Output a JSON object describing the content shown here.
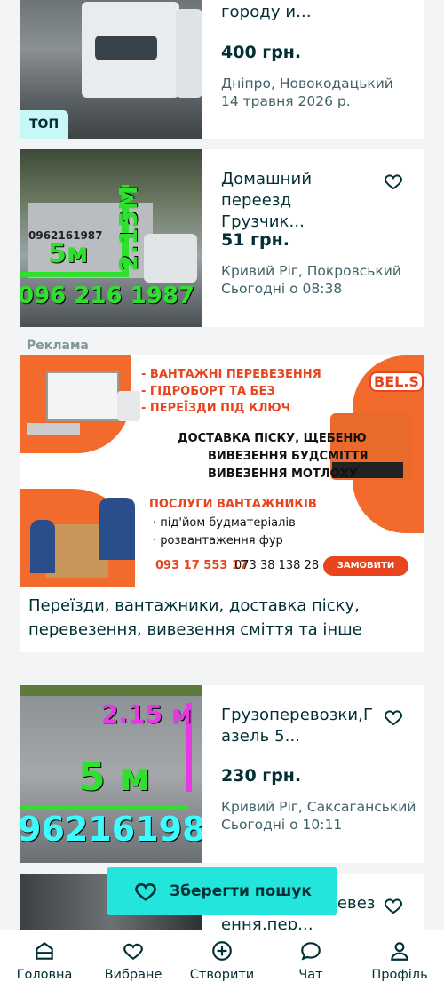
{
  "listings": [
    {
      "title": "Перевезення по городу и...",
      "price": "400 грн.",
      "location": "Дніпро, Новокодацький",
      "date": "14 травня 2026 р.",
      "badge": "ТОП"
    },
    {
      "title": "Домашний переезд Грузчик...",
      "price": "51 грн.",
      "location": "Кривий Ріг, Покровський",
      "date": "Сьогодні о 08:38",
      "photo_text": {
        "side": "2.15M",
        "length": "5м",
        "phone": "096 216 1987",
        "phone_small": "0962161987"
      }
    },
    {
      "title": "Грузоперевозки,Газель 5...",
      "price": "230 грн.",
      "location": "Кривий Ріг, Саксаганський",
      "date": "Сьогодні о 10:11",
      "photo_text": {
        "side": "2.15 м",
        "length": "5 м",
        "phone": "96216198"
      }
    },
    {
      "title": "Вантажні перевезення,пер..."
    }
  ],
  "ad": {
    "label": "Реклама",
    "description": "Переїзди, вантажники, доставка піску, перевезення, вивезення сміття та інше",
    "banner": {
      "brand": "BEL.S",
      "line1": "- ВАНТАЖНІ ПЕРЕВЕЗЕННЯ",
      "line2": "- ГІДРОБОРТ ТА БЕЗ",
      "line3": "- ПЕРЕЇЗДИ ПІД КЛЮЧ",
      "line4": "ДОСТАВКА ПІСКУ, ЩЕБЕНЮ",
      "line5": "ВИВЕЗЕННЯ БУДСМІТТЯ",
      "line6": "ВИВЕЗЕННЯ МОТЛОХУ",
      "line7": "ПОСЛУГИ ВАНТАЖНИКІВ",
      "line8": "· під'йом будматеріалів",
      "line9": "· розвантаження фур",
      "phone1": "093 17 553 17",
      "phone2": "073 38 138 28",
      "cta": "ЗАМОВИТИ"
    }
  },
  "save_search": {
    "label": "Зберегти пошук"
  },
  "nav": [
    {
      "label": "Головна",
      "icon": "home-icon"
    },
    {
      "label": "Вибране",
      "icon": "heart-icon"
    },
    {
      "label": "Створити",
      "icon": "plus-circle-icon"
    },
    {
      "label": "Чат",
      "icon": "chat-icon"
    },
    {
      "label": "Профіль",
      "icon": "profile-icon"
    }
  ],
  "colors": {
    "accent": "#23e5db",
    "text": "#002f34",
    "muted": "#406367",
    "badge": "#c8f8f6",
    "banner_red": "#e8451e"
  }
}
